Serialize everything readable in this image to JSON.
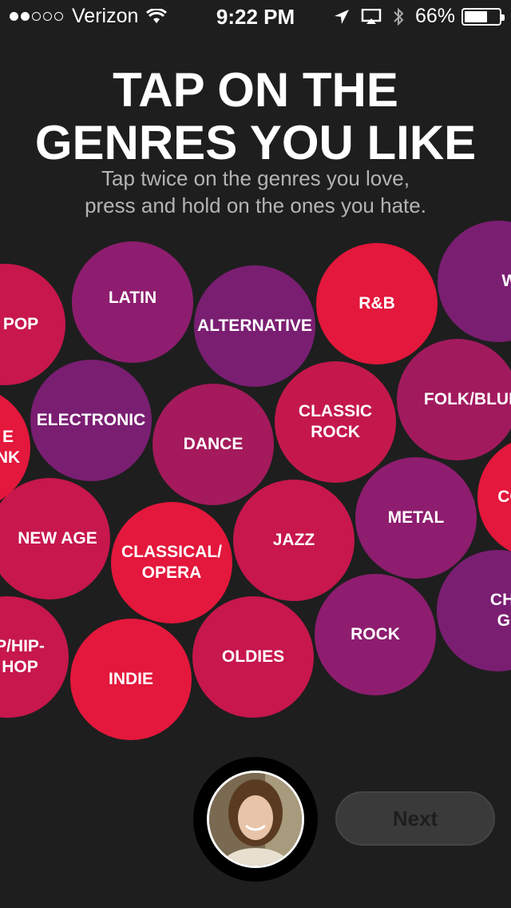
{
  "status_bar": {
    "carrier": "Verizon",
    "time": "9:22 PM",
    "battery": "66%",
    "battery_level": 0.66
  },
  "header": {
    "title": "TAP ON THE\nGENRES YOU LIKE",
    "subtitle": "Tap twice on the genres you love,\npress and hold on the ones you hate."
  },
  "genres": [
    {
      "label": "POP",
      "color": "#c7174c"
    },
    {
      "label": "LATIN",
      "color": "#8e1d6f"
    },
    {
      "label": "ALTERNATIVE",
      "color": "#7a1e72"
    },
    {
      "label": "R&B",
      "color": "#e4173c"
    },
    {
      "label": "WOR",
      "color": "#7a1e72"
    },
    {
      "label": "E\nNK",
      "color": "#e4173c"
    },
    {
      "label": "ELECTRONIC",
      "color": "#7a1e72"
    },
    {
      "label": "DANCE",
      "color": "#a41a5c"
    },
    {
      "label": "CLASSIC\nROCK",
      "color": "#c4184c"
    },
    {
      "label": "FOLK/BLUES",
      "color": "#a21a5e"
    },
    {
      "label": "NEW AGE",
      "color": "#c7174c"
    },
    {
      "label": "CLASSICAL/\nOPERA",
      "color": "#e4173c"
    },
    {
      "label": "JAZZ",
      "color": "#c7174c"
    },
    {
      "label": "METAL",
      "color": "#8e1d6f"
    },
    {
      "label": "CO",
      "color": "#e4173c"
    },
    {
      "label": "P/HIP-\nHOP",
      "color": "#c7174c"
    },
    {
      "label": "INDIE",
      "color": "#e4173c"
    },
    {
      "label": "OLDIES",
      "color": "#c7174c"
    },
    {
      "label": "ROCK",
      "color": "#8e1d6f"
    },
    {
      "label": "CHRIST\nGOSP",
      "color": "#7a1e72"
    }
  ],
  "footer": {
    "avatar_icon": "user-avatar",
    "next_label": "Next"
  }
}
